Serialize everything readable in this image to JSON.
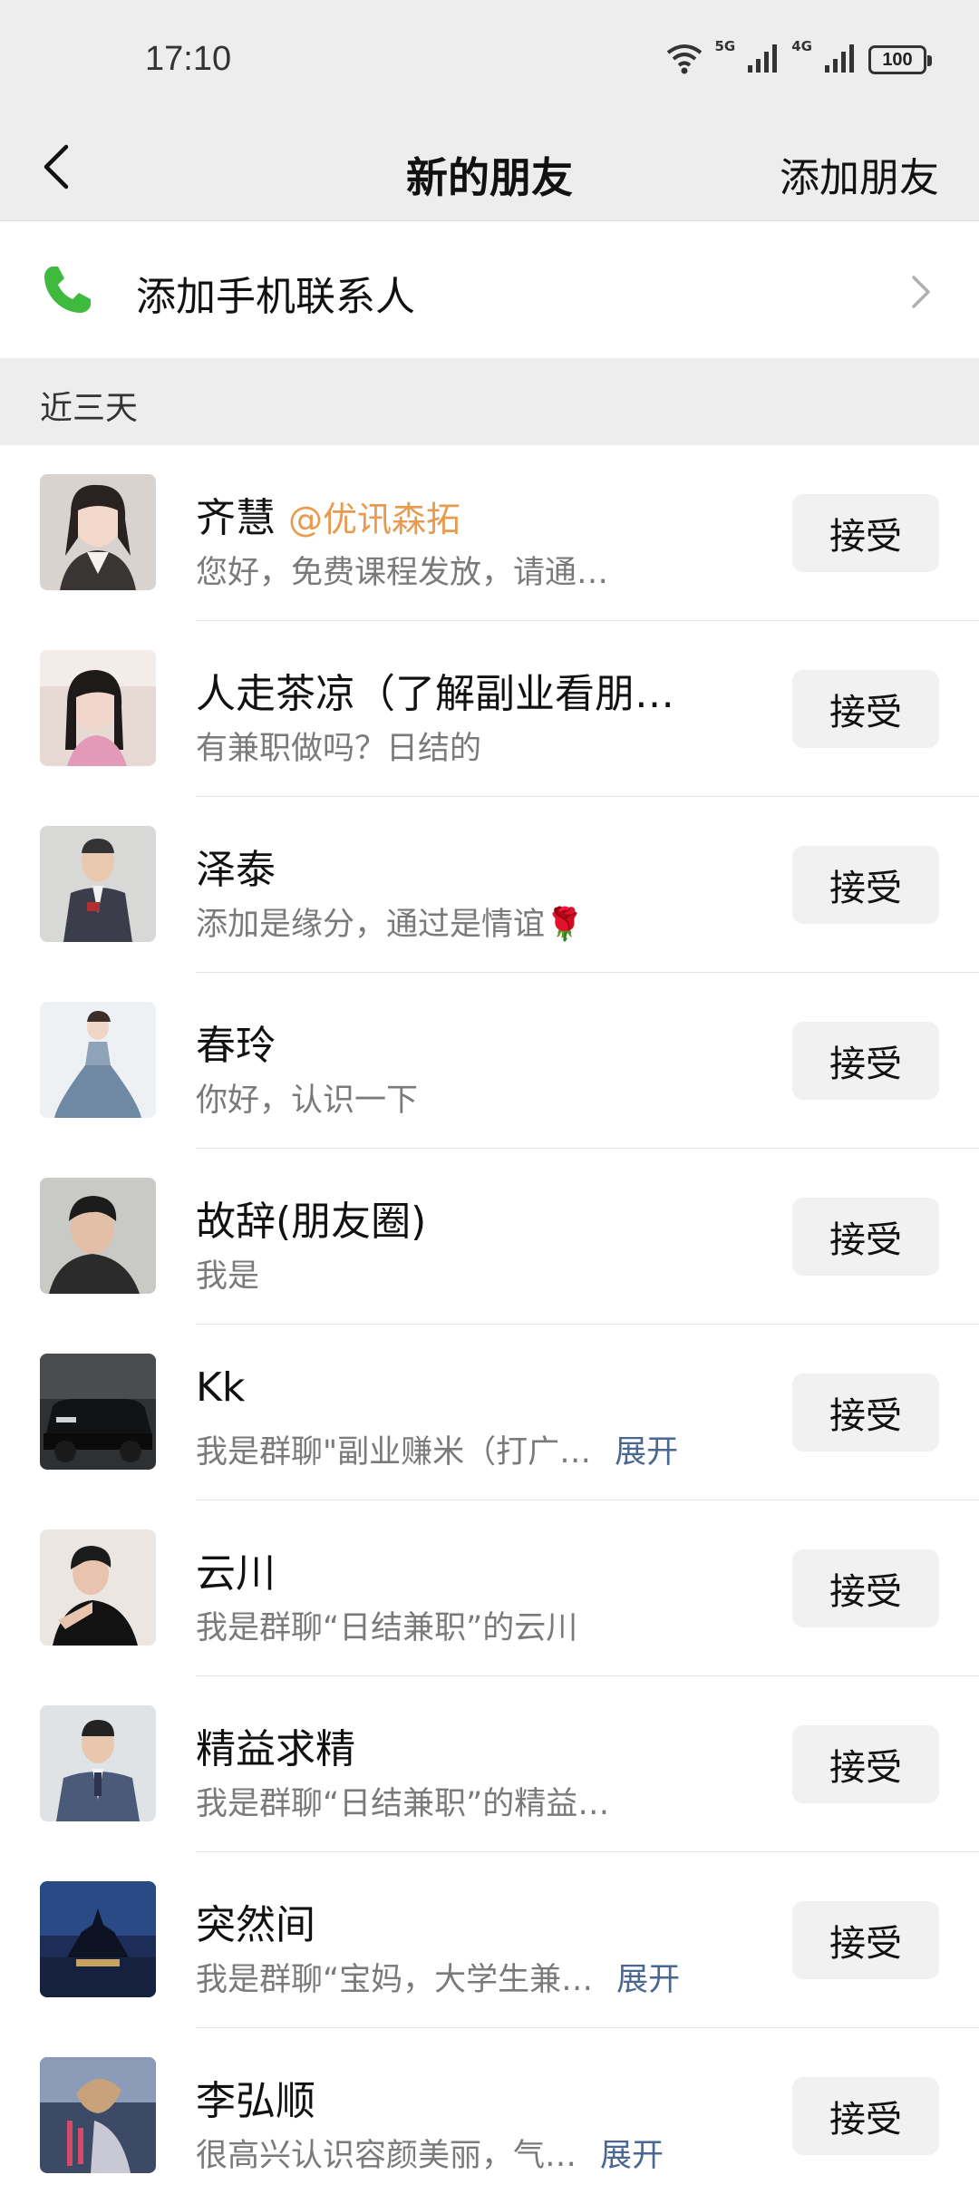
{
  "status": {
    "time": "17:10",
    "signal1": "5G",
    "signal2": "4G",
    "battery": "100"
  },
  "nav": {
    "title": "新的朋友",
    "add_label": "添加朋友"
  },
  "phone_contacts": {
    "label": "添加手机联系人"
  },
  "section": {
    "label": "近三天"
  },
  "accept_label": "接受",
  "requests": [
    {
      "name": "齐慧",
      "tag": "@优讯森拓",
      "message": "您好，免费课程发放，请通过一下",
      "expand": ""
    },
    {
      "name": "人走茶凉（了解副业看朋…",
      "tag": "",
      "message": "有兼职做吗？日结的",
      "expand": ""
    },
    {
      "name": "泽泰",
      "tag": "",
      "message": "添加是缘分，通过是情谊🌹",
      "expand": ""
    },
    {
      "name": "春玲",
      "tag": "",
      "message": "你好，认识一下",
      "expand": ""
    },
    {
      "name": "故辞(朋友圈)",
      "tag": "",
      "message": "我是",
      "expand": ""
    },
    {
      "name": "Kk",
      "tag": "",
      "message": "我是群聊\"副业赚米（打广…",
      "expand": "展开"
    },
    {
      "name": "云川",
      "tag": "",
      "message": "我是群聊“日结兼职”的云川",
      "expand": ""
    },
    {
      "name": "精益求精",
      "tag": "",
      "message": "我是群聊“日结兼职”的精益求精",
      "expand": ""
    },
    {
      "name": "突然间",
      "tag": "",
      "message": "我是群聊“宝妈，大学生兼…",
      "expand": "展开"
    },
    {
      "name": "李弘顺",
      "tag": "",
      "message": "很高兴认识容颜美丽，气…",
      "expand": "展开"
    }
  ]
}
